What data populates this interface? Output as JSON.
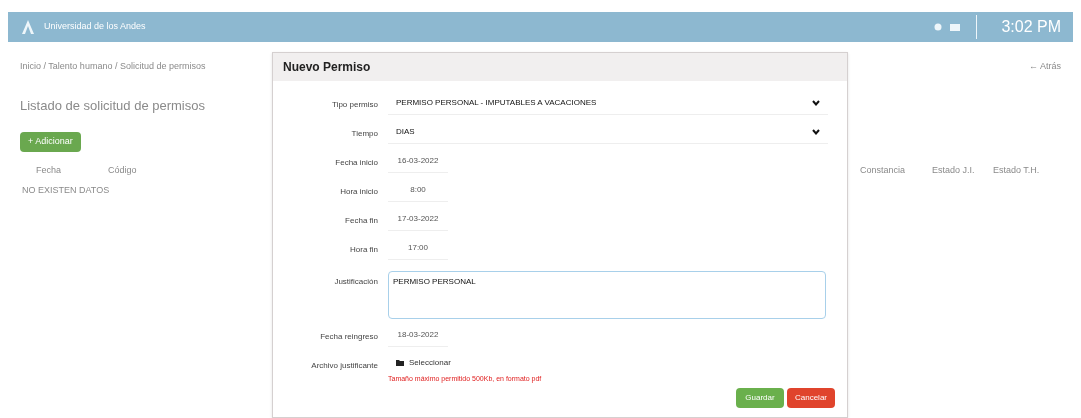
{
  "header": {
    "brand": "Universidad de los Andes",
    "clock": "3:02 PM"
  },
  "page": {
    "breadcrumb": "Inicio / Talento humano / Solicitud de permisos",
    "back": "← Atrás",
    "title": "Listado de solicitud de permisos",
    "add_button": "+ Adicionar",
    "table": {
      "columns": [
        "Fecha",
        "Código",
        "Constancia",
        "Estado J.I.",
        "Estado T.H."
      ],
      "empty": "NO EXISTEN DATOS"
    }
  },
  "modal": {
    "title": "Nuevo Permiso",
    "fields": [
      {
        "kind": "select",
        "label": "Tipo permiso",
        "value": "PERMISO PERSONAL - IMPUTABLES A VACACIONES"
      },
      {
        "kind": "select",
        "label": "Tiempo",
        "value": "DIAS"
      },
      {
        "kind": "input",
        "label": "Fecha inicio",
        "value": "16-03-2022"
      },
      {
        "kind": "input",
        "label": "Hora inicio",
        "value": "8:00"
      },
      {
        "kind": "input",
        "label": "Fecha fin",
        "value": "17-03-2022"
      },
      {
        "kind": "input",
        "label": "Hora fin",
        "value": "17:00"
      },
      {
        "kind": "textarea",
        "label": "Justificación",
        "value": "PERMISO PERSONAL"
      },
      {
        "kind": "input",
        "label": "Fecha reingreso",
        "value": "18-03-2022"
      },
      {
        "kind": "file",
        "label": "Archivo justificante",
        "value": "Seleccionar",
        "hint": "Tamaño máximo permitido 500Kb, en formato pdf"
      }
    ],
    "buttons": [
      {
        "kind": "save",
        "label": "Guardar"
      },
      {
        "kind": "cancel",
        "label": "Cancelar"
      }
    ]
  }
}
